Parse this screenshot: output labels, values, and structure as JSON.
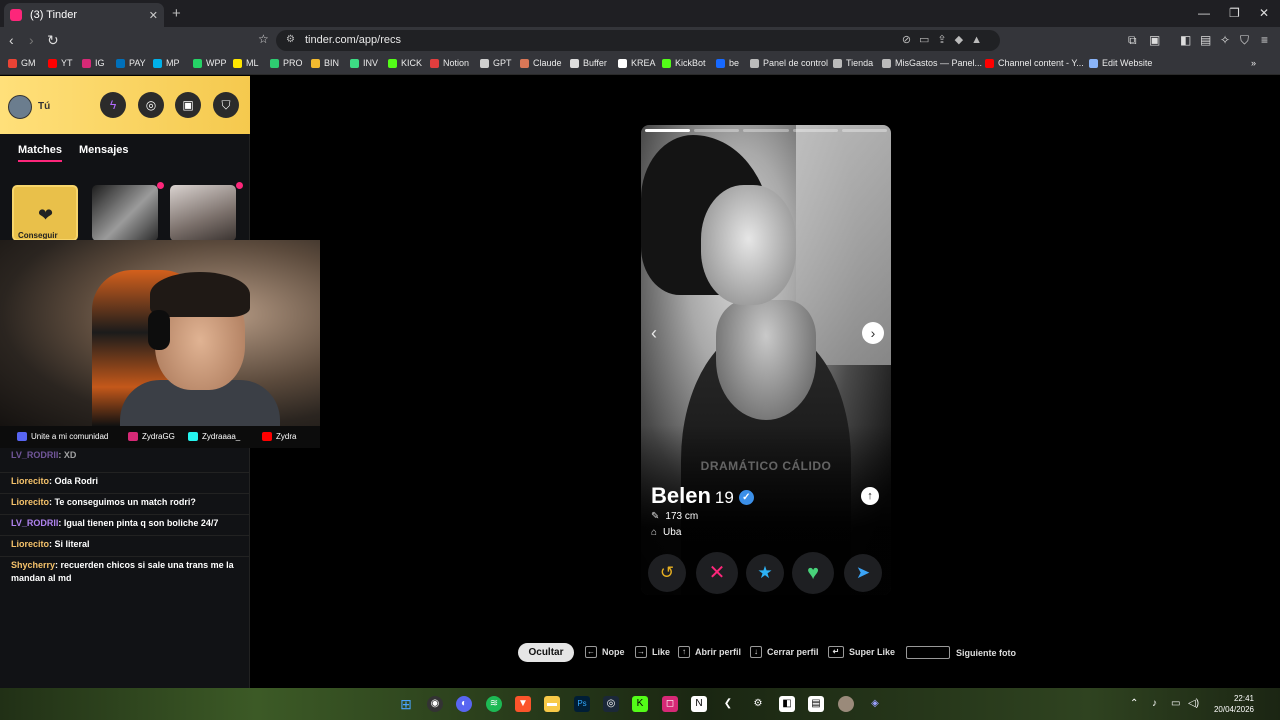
{
  "browser": {
    "tab_title": "(3) Tinder",
    "url": "tinder.com/app/recs",
    "bookmarks": [
      {
        "label": "GM",
        "color": "#ea4335"
      },
      {
        "label": "YT",
        "color": "#ff0000"
      },
      {
        "label": "IG",
        "color": "#d62976"
      },
      {
        "label": "PAY",
        "color": "#0070ba"
      },
      {
        "label": "MP",
        "color": "#00b1ea"
      },
      {
        "label": "WPP",
        "color": "#25d366"
      },
      {
        "label": "ML",
        "color": "#ffe600"
      },
      {
        "label": "PRO",
        "color": "#2ecc71"
      },
      {
        "label": "BIN",
        "color": "#f3ba2f"
      },
      {
        "label": "INV",
        "color": "#3ddc84"
      },
      {
        "label": "KICK",
        "color": "#53fc18"
      },
      {
        "label": "Notion",
        "color": "#e03e3e"
      },
      {
        "label": "GPT",
        "color": "#cfcfcf"
      },
      {
        "label": "Claude",
        "color": "#d97757"
      },
      {
        "label": "Buffer",
        "color": "#dddddd"
      },
      {
        "label": "KREA",
        "color": "#ffffff"
      },
      {
        "label": "KickBot",
        "color": "#53fc18"
      },
      {
        "label": "be",
        "color": "#1769ff"
      },
      {
        "label": "Panel de control",
        "color": "#bbbbbb"
      },
      {
        "label": "Tienda",
        "color": "#bbbbbb"
      },
      {
        "label": "MisGastos — Panel...",
        "color": "#bbbbbb"
      },
      {
        "label": "Channel content - Y...",
        "color": "#ff0000"
      },
      {
        "label": "Edit Website",
        "color": "#8ab4f8"
      }
    ]
  },
  "sidebar": {
    "user_label": "Tú",
    "tabs": [
      "Matches",
      "Mensajes"
    ],
    "likes_card_label": "Conseguir"
  },
  "stream": {
    "socials": [
      {
        "label": "Unite a mi comunidad",
        "color": "#5865f2"
      },
      {
        "label": "ZydraGG",
        "color": "#d62976"
      },
      {
        "label": "Zydraaaa_",
        "color": "#25f4ee"
      },
      {
        "label": "Zydra",
        "color": "#ff0000"
      }
    ]
  },
  "chat": [
    {
      "user": "LV_RODRII",
      "color": "#b083f0",
      "text": "XD"
    },
    {
      "user": "Liorecito",
      "color": "#f5c26b",
      "text": "Oda Rodri"
    },
    {
      "user": "Liorecito",
      "color": "#f5c26b",
      "text": "Te conseguimos un match rodri?"
    },
    {
      "user": "LV_RODRII",
      "color": "#b083f0",
      "text": "Igual tienen pinta q son boliche 24/7"
    },
    {
      "user": "Liorecito",
      "color": "#f5c26b",
      "text": "Si literal"
    },
    {
      "user": "Shycherry",
      "color": "#f5c26b",
      "text": "recuerden chicos si sale una trans me la mandan al md"
    }
  ],
  "profile": {
    "name": "Belen",
    "age": "19",
    "height": "173 cm",
    "school": "Uba",
    "photo_caption": "DRAMÁTICO CÁLIDO",
    "photo_count": 5,
    "active_photo": 1
  },
  "actions": [
    {
      "name": "rewind-button",
      "glyph": "↺",
      "color": "#e8b021"
    },
    {
      "name": "nope-button",
      "glyph": "✕",
      "color": "#fd267a"
    },
    {
      "name": "super-like-button",
      "glyph": "★",
      "color": "#2db2f5"
    },
    {
      "name": "like-button",
      "glyph": "♥",
      "color": "#48d27a"
    },
    {
      "name": "boost-button",
      "glyph": "➤",
      "color": "#3ba3f5"
    }
  ],
  "hints": {
    "hide": "Ocultar",
    "nope": "Nope",
    "like": "Like",
    "open_profile": "Abrir perfil",
    "close_profile": "Cerrar perfil",
    "super_like": "Super Like",
    "next_photo": "Siguiente foto"
  },
  "taskbar": {
    "time": "22:41",
    "date": "20/04/2026"
  }
}
